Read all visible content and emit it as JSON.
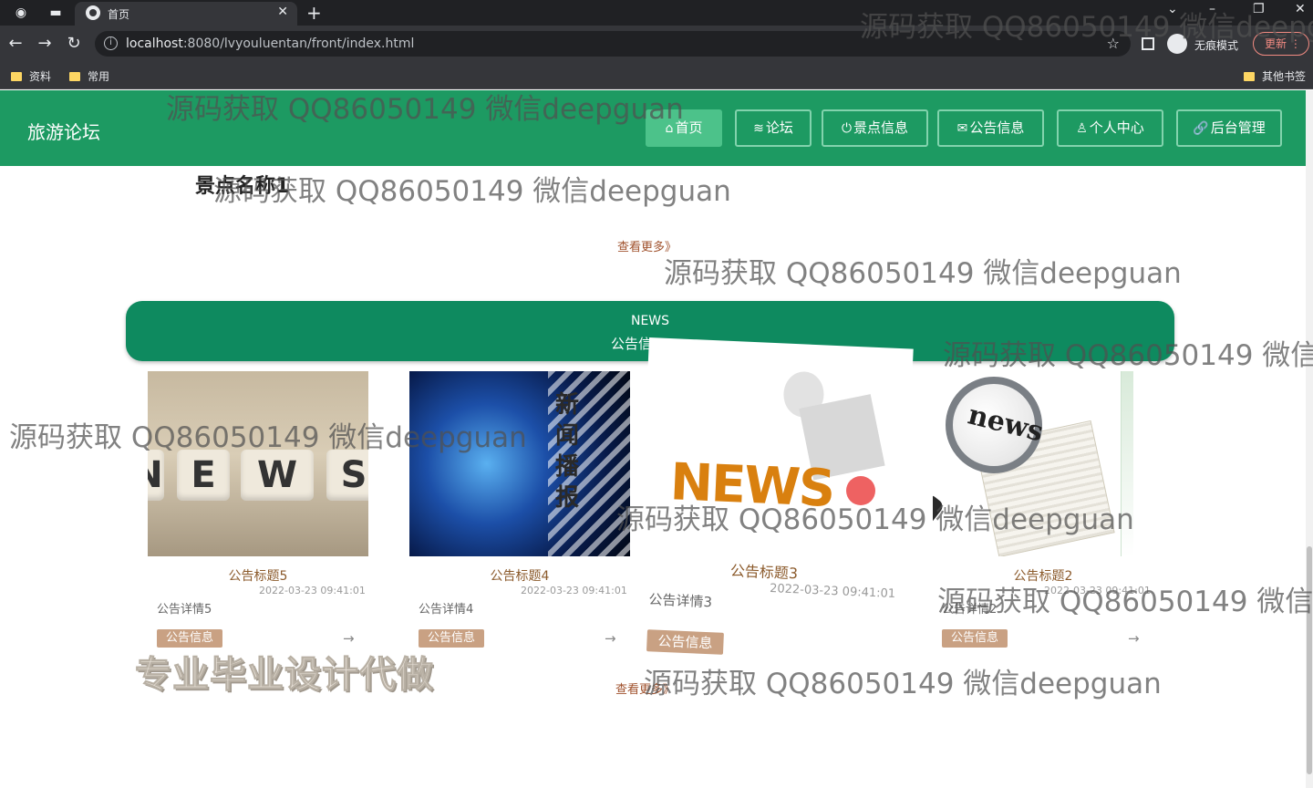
{
  "browser": {
    "tab_title": "首页",
    "new_tab": "+",
    "url_host": "localhost",
    "url_rest": ":8080/lvyouluentan/front/index.html",
    "incognito_label": "无痕模式",
    "update_label": "更新",
    "bookmarks": [
      "资料",
      "常用"
    ],
    "other_bookmarks": "其他书签"
  },
  "header": {
    "brand": "旅游论坛",
    "nav": [
      {
        "icon": "⌂",
        "label": "首页"
      },
      {
        "icon": "≋",
        "label": "论坛"
      },
      {
        "icon": "⏻",
        "label": "景点信息"
      },
      {
        "icon": "✉",
        "label": "公告信息"
      },
      {
        "icon": "♙",
        "label": "个人中心"
      },
      {
        "icon": "🔗",
        "label": "后台管理"
      }
    ]
  },
  "spots": {
    "name": "景点名称1",
    "more": "查看更多》"
  },
  "news": {
    "banner_en": "NEWS",
    "banner_cn": "公告信",
    "items": [
      {
        "title": "公告标题5",
        "time": "2022-03-23 09:41:01",
        "desc": "公告详情5",
        "tag": "公告信息"
      },
      {
        "title": "公告标题4",
        "time": "2022-03-23 09:41:01",
        "desc": "公告详情4",
        "tag": "公告信息"
      },
      {
        "title": "公告标题3",
        "time": "2022-03-23 09:41:01",
        "desc": "公告详情3",
        "tag": "公告信息"
      },
      {
        "title": "公告标题2",
        "time": "2022-03-23 09:41:01",
        "desc": "公告详情2",
        "tag": "公告信息"
      }
    ],
    "more": "查看更多》",
    "image_texts": {
      "dice": [
        "N",
        "E",
        "W",
        "S"
      ],
      "vertical": "新闻播报",
      "news_word": "NEWS",
      "lens": "news"
    }
  },
  "overlay": {
    "watermark": "源码获取 QQ86050149 微信deepguan",
    "watermark_cut": "源码获取 QQ86050149 微信d",
    "watermark_top": "源码获取 QQ86050149 微信deepgu",
    "promo": "专业毕业设计代做"
  },
  "colors": {
    "header_green": "#1d9a62",
    "banner_green": "#0e8a5f",
    "tag_bg": "#c9a183"
  }
}
